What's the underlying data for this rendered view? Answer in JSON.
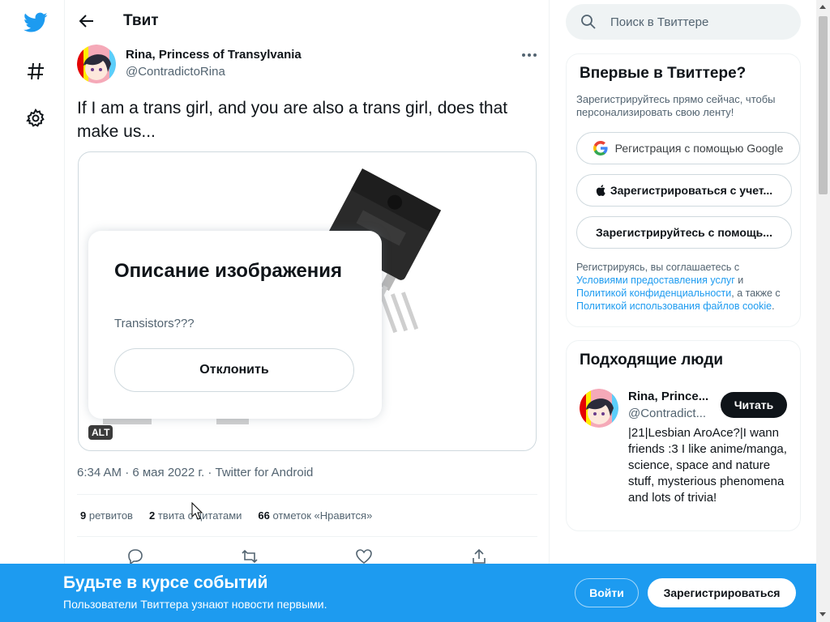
{
  "header": {
    "title": "Твит"
  },
  "tweet": {
    "author_name": "Rina, Princess of Transylvania",
    "author_handle": "@ContradictoRina",
    "text": "If I am a trans girl, and you are also a trans girl, does that make us...",
    "media": {
      "alt_badge": "ALT",
      "description_title": "Описание изображения",
      "description_text": "Transistors???",
      "dismiss_label": "Отклонить"
    },
    "meta": "6:34 AM · 6 мая 2022 г. · Twitter for Android",
    "stats": {
      "retweets_count": "9",
      "retweets_label": "ретвитов",
      "quotes_count": "2",
      "quotes_label": "твита с цитатами",
      "likes_count": "66",
      "likes_label": "отметок «Нравится»"
    }
  },
  "search": {
    "placeholder": "Поиск в Твиттере"
  },
  "new_panel": {
    "title": "Впервые в Твиттере?",
    "subtitle": "Зарегистрируйтесь прямо сейчас, чтобы персонализировать свою ленту!",
    "google_label": "Регистрация с помощью Google",
    "apple_label": "Зарегистрироваться с учет...",
    "other_label": "Зарегистрируйтесь с помощь...",
    "terms_pre": "Регистрируясь, вы соглашаетесь с ",
    "terms_link1": "Условиями предоставления услуг",
    "terms_mid1": " и ",
    "terms_link2": "Политикой конфиденциальности",
    "terms_mid2": ", а также с ",
    "terms_link3": "Политикой использования файлов cookie",
    "terms_post": "."
  },
  "people_panel": {
    "title": "Подходящие люди",
    "name": "Rina, Prince...",
    "handle": "@Contradict...",
    "follow_label": "Читать",
    "bio": "|21|Lesbian AroAce?|I wann friends :3 I like anime/manga, science, space and nature stuff, mysterious phenomena and lots of trivia!"
  },
  "banner": {
    "title": "Будьте в курсе событий",
    "subtitle": "Пользователи Твиттера узнают новости первыми.",
    "login_label": "Войти",
    "register_label": "Зарегистрироваться"
  },
  "colors": {
    "accent": "#1d9bf0",
    "text": "#0f1419",
    "muted": "#536471"
  }
}
